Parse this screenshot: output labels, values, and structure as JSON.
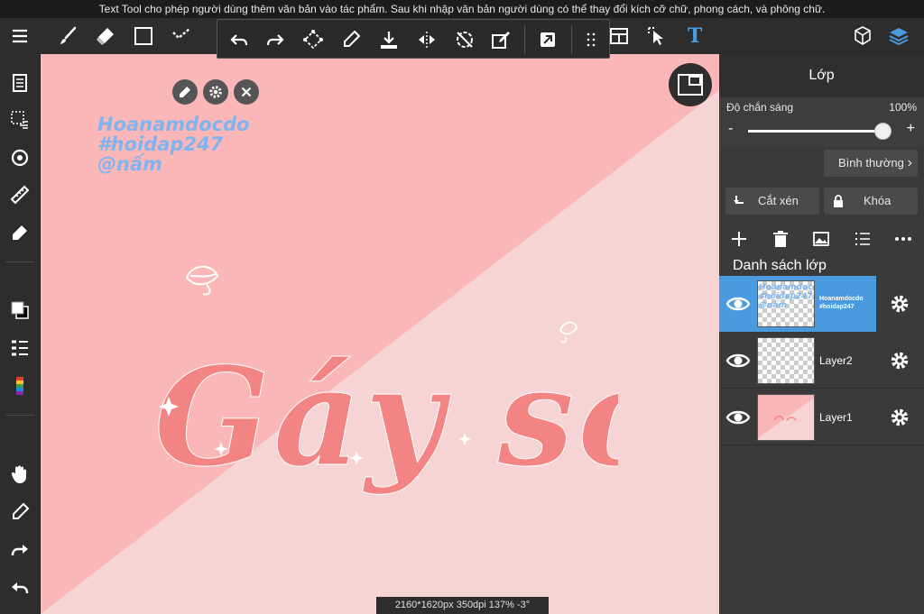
{
  "tooltip": "Text Tool cho phép người dùng thêm văn bản vào tác phẩm. Sau khi nhập văn bản người dùng có thể thay đổi kích cỡ chữ, phong cách, và phông chữ.",
  "toolbar": {
    "tools": [
      "menu-icon",
      "brush-icon",
      "eraser-icon",
      "rectangle-icon",
      "selection-icon",
      "layout-icon",
      "cursor-icon",
      "text-tool-icon",
      "3d-icon",
      "layers-icon"
    ],
    "text_tool_glyph": "T",
    "popup_actions": [
      "undo-icon",
      "redo-icon",
      "transform-icon",
      "eyedropper-icon",
      "fill-icon",
      "flip-icon",
      "rotate-icon",
      "edit-icon",
      "arrow-icon",
      "grid-icon"
    ]
  },
  "canvas": {
    "text_lines": [
      "Hoanamdocdo",
      "#hoidap247",
      "@nấm"
    ],
    "art_text": "Gáy sớm",
    "status": "2160*1620px 350dpi 137% -3°",
    "colors": {
      "upper": "#fbb7b7",
      "lower": "#f6d4d6",
      "art": "#f28484",
      "text": "#7fb4ee"
    }
  },
  "panel": {
    "title": "Lớp",
    "opacity_label": "Độ chắn sáng",
    "opacity_value": "100%",
    "opacity_level": 1.0,
    "minus": "-",
    "plus": "+",
    "blend_mode": "Bình thường",
    "blend_chevron": "›",
    "clip_label": "Cắt xén",
    "lock_label": "Khóa",
    "layer_list_title": "Danh sách lớp",
    "layers": [
      {
        "name": "Hoanamdocdo #hoidap247",
        "selected": true
      },
      {
        "name": "Layer2",
        "selected": false
      },
      {
        "name": "Layer1",
        "selected": false
      }
    ],
    "thumb_text": [
      "Hoanamdocdo",
      "#hoidap247",
      "@nấm"
    ],
    "thumb_name_lines": [
      "Hoanamdocdo",
      "#hoidap247"
    ],
    "accent": "#4a9ae0"
  }
}
